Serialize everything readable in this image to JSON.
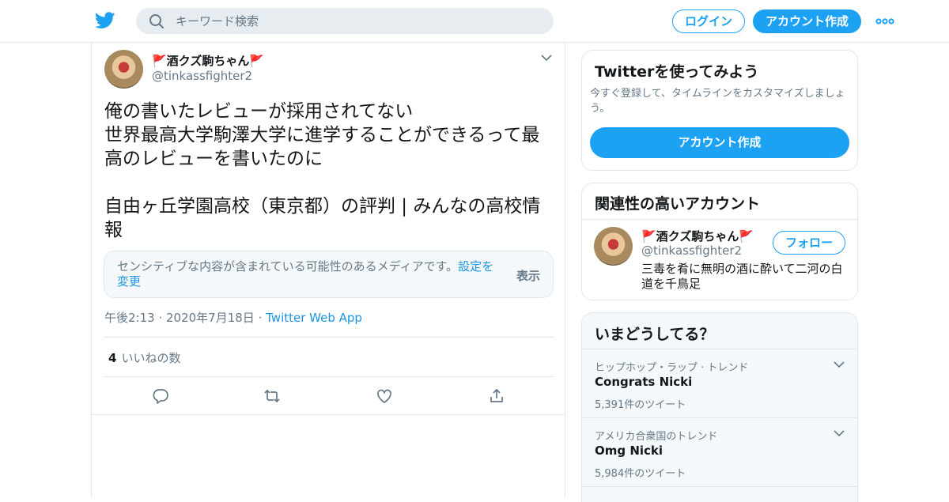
{
  "header": {
    "search_placeholder": "キーワード検索",
    "login_label": "ログイン",
    "signup_label": "アカウント作成",
    "brand_color": "#1da1f2"
  },
  "tweet": {
    "author_name": "🚩酒クズ駒ちゃん🚩",
    "author_handle": "@tinkassfighter2",
    "text": "俺の書いたレビューが採用されてない\n世界最高大学駒澤大学に進学することができるって最高のレビューを書いたのに\n\n自由ヶ丘学園高校（東京都）の評判 | みんなの高校情報",
    "sensitive_notice": "センシティブな内容が含まれている可能性のあるメディアです。",
    "sensitive_link": "設定を変更",
    "sensitive_show": "表示",
    "time": "午後2:13",
    "date": "2020年7月18日",
    "source": "Twitter Web App",
    "likes_count": "4",
    "likes_label": "いいねの数"
  },
  "sidebar": {
    "signup_card": {
      "title": "Twitterを使ってみよう",
      "description": "今すぐ登録して、タイムラインをカスタマイズしましょう。",
      "button": "アカウント作成"
    },
    "related": {
      "title": "関連性の高いアカウント",
      "name": "🚩酒クズ駒ちゃん🚩",
      "handle": "@tinkassfighter2",
      "follow_label": "フォロー",
      "bio": "三毒を肴に無明の酒に酔いて二河の白道を千鳥足"
    },
    "trends": {
      "title": "いまどうしてる？",
      "items": [
        {
          "category": "ヒップホップ・ラップ · トレンド",
          "name": "Congrats Nicki",
          "count": "5,391件のツイート"
        },
        {
          "category": "アメリカ合衆国のトレンド",
          "name": "Omg Nicki",
          "count": "5,984件のツイート"
        }
      ]
    }
  }
}
